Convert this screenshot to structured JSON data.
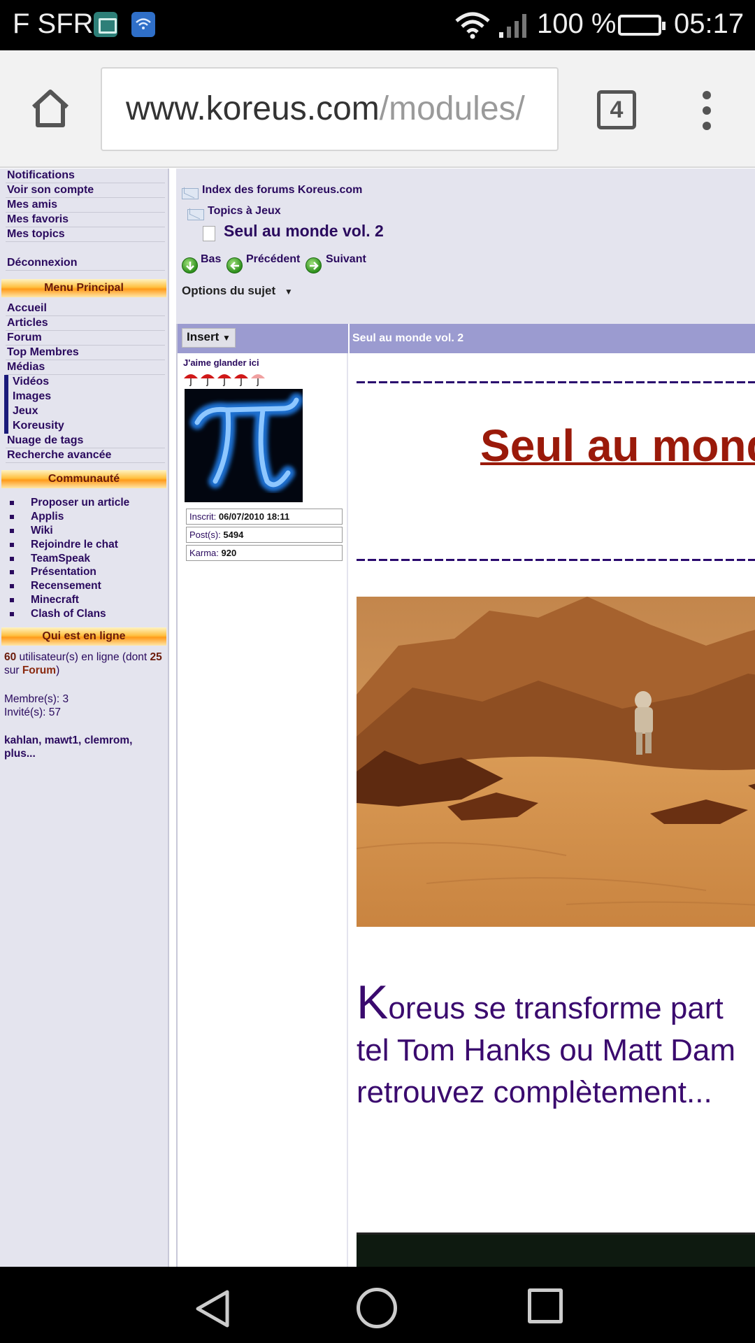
{
  "status_bar": {
    "carrier": "F SFR",
    "battery_percent": "100 %",
    "time": "05:17",
    "icons": [
      "image-notification-icon",
      "wifi-notification-icon",
      "wifi-icon",
      "signal-icon",
      "battery-icon"
    ]
  },
  "browser": {
    "url_host": "www.koreus.com",
    "url_path": "/modules/",
    "tab_count": "4"
  },
  "sidebar": {
    "account_links": [
      "Notifications",
      "Voir son compte",
      "Mes amis",
      "Mes favoris",
      "Mes topics"
    ],
    "logout": "Déconnexion",
    "menu_header": "Menu Principal",
    "menu_items": [
      "Accueil",
      "Articles",
      "Forum",
      "Top Membres",
      "Médias"
    ],
    "media_sub_items": [
      "Vidéos",
      "Images",
      "Jeux",
      "Koreusity"
    ],
    "menu_items_after": [
      "Nuage de tags",
      "Recherche avancée"
    ],
    "community_header": "Communauté",
    "community_items": [
      "Proposer un article",
      "Applis",
      "Wiki",
      "Rejoindre le chat",
      "TeamSpeak",
      "Présentation",
      "Recensement",
      "Minecraft",
      "Clash of Clans"
    ],
    "online_header": "Qui est en ligne",
    "online": {
      "users_count": "60",
      "users_text_1": " utilisateur(s) en ligne (dont ",
      "forum_count": "25",
      "users_text_2": " sur ",
      "forum_link": "Forum",
      "users_text_3": ")",
      "members": "Membre(s): 3",
      "guests": "Invité(s): 57",
      "names": "kahlan, mawt1, clemrom,",
      "more": "plus..."
    }
  },
  "content": {
    "breadcrumb": [
      "Index des forums Koreus.com",
      "Topics à Jeux"
    ],
    "topic_title": "Seul au monde vol. 2",
    "nav": {
      "down": "Bas",
      "previous": "Précédent",
      "next": "Suivant"
    },
    "options_label": "Options du sujet",
    "post": {
      "insert_label": "Insert",
      "header_title": "Seul au monde vol. 2",
      "author": {
        "rank": "J'aime glander ici",
        "rank_icons": 5,
        "registered_label": "Inscrit:",
        "registered_value": "06/07/2010 18:11",
        "posts_label": "Post(s):",
        "posts_value": "5494",
        "karma_label": "Karma:",
        "karma_value": "920"
      },
      "title": "Seul au mond",
      "intro_dropcap": "K",
      "intro_lines": [
        "oreus se transforme part",
        "tel Tom Hanks ou Matt Dam",
        "retrouvez complètement..."
      ]
    }
  },
  "colors": {
    "link": "#2a0a5e",
    "header_orange": "#ff9a1a",
    "post_header": "#9b9bd0",
    "title_red": "#9a1a0a"
  }
}
